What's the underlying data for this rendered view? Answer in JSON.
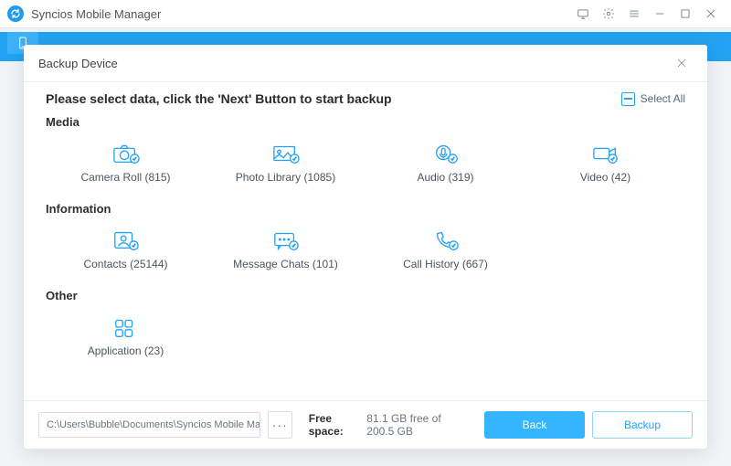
{
  "app": {
    "title": "Syncios Mobile Manager"
  },
  "modal": {
    "title": "Backup Device",
    "instruction": "Please select data, click the 'Next' Button to start backup",
    "select_all_label": "Select All"
  },
  "sections": {
    "media": {
      "title": "Media",
      "items": [
        {
          "name": "Camera Roll",
          "count": 815
        },
        {
          "name": "Photo Library",
          "count": 1085
        },
        {
          "name": "Audio",
          "count": 319
        },
        {
          "name": "Video",
          "count": 42
        }
      ]
    },
    "information": {
      "title": "Information",
      "items": [
        {
          "name": "Contacts",
          "count": 25144
        },
        {
          "name": "Message Chats",
          "count": 101
        },
        {
          "name": "Call History",
          "count": 667
        }
      ]
    },
    "other": {
      "title": "Other",
      "items": [
        {
          "name": "Application",
          "count": 23
        }
      ]
    }
  },
  "footer": {
    "path": "C:\\Users\\Bubble\\Documents\\Syncios Mobile Manager\\One Key Bac",
    "browse": "···",
    "free_label": "Free space:",
    "free_value": "81.1 GB free of 200.5 GB",
    "back": "Back",
    "backup": "Backup"
  }
}
